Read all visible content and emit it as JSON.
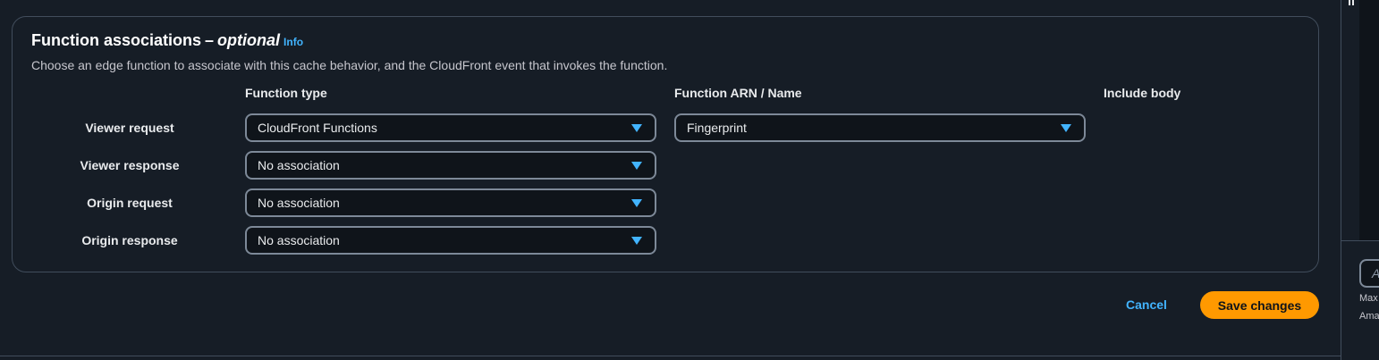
{
  "section": {
    "title": "Function associations",
    "title_dash": "–",
    "title_optional": "optional",
    "info_link": "Info",
    "description": "Choose an edge function to associate with this cache behavior, and the CloudFront event that invokes the function."
  },
  "columns": {
    "function_type": "Function type",
    "function_arn": "Function ARN / Name",
    "include_body": "Include body"
  },
  "rows": [
    {
      "label": "Viewer request",
      "function_type": "CloudFront Functions",
      "function_arn": "Fingerprint"
    },
    {
      "label": "Viewer response",
      "function_type": "No association"
    },
    {
      "label": "Origin request",
      "function_type": "No association"
    },
    {
      "label": "Origin response",
      "function_type": "No association"
    }
  ],
  "actions": {
    "cancel": "Cancel",
    "save": "Save changes"
  },
  "side_panel": {
    "input_placeholder": "A",
    "note_1": "Max",
    "note_2": "Ama"
  },
  "colors": {
    "background": "#161d26",
    "accent_link": "#42b4ff",
    "primary_button": "#ff9900",
    "border": "#7d8998"
  }
}
